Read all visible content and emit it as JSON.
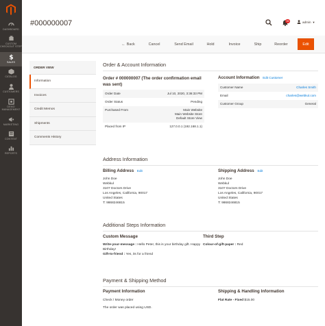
{
  "nav": {
    "items": [
      {
        "label": "Dashboard",
        "icon": "dashboard-icon"
      },
      {
        "label": "Custom Checkout Step",
        "icon": "checkout-step-icon"
      },
      {
        "label": "Sales",
        "icon": "dollar-icon"
      },
      {
        "label": "Catalog",
        "icon": "catalog-icon"
      },
      {
        "label": "Customers",
        "icon": "customers-icon"
      },
      {
        "label": "Demo Management",
        "icon": "demo-management-icon"
      },
      {
        "label": "Marketing",
        "icon": "marketing-icon"
      },
      {
        "label": "Content",
        "icon": "content-icon"
      },
      {
        "label": "Reports",
        "icon": "reports-icon"
      }
    ],
    "accent": "#eb5202"
  },
  "header": {
    "title": "#000000007",
    "notification_count": "39",
    "user": "admin"
  },
  "actions": {
    "back": "Back",
    "cancel": "Cancel",
    "send_email": "Send Email",
    "hold": "Hold",
    "invoice": "Invoice",
    "ship": "Ship",
    "reorder": "Reorder",
    "edit": "Edit"
  },
  "tabs": {
    "title": "Order View",
    "items": [
      "Information",
      "Invoices",
      "Credit Memos",
      "Shipments",
      "Comments History"
    ]
  },
  "order_account": {
    "section_title": "Order & Account Information",
    "order_heading": "Order # 000000007 (The order confirmation email was sent)",
    "rows": [
      {
        "label": "Order Date",
        "value": "Jul 10, 2020, 3:36:33 PM"
      },
      {
        "label": "Order Status",
        "value": "Pending"
      },
      {
        "label": "Purchased From",
        "value_lines": [
          "Main Website",
          "Main Website Store",
          "Default Store View"
        ]
      },
      {
        "label": "Placed from IP",
        "value": "127.0.0.1 (192.168.1.1)"
      }
    ],
    "account_heading": "Account Information",
    "account_edit": "Edit Customer",
    "account_rows": [
      {
        "label": "Customer Name",
        "value": "Charles Smith"
      },
      {
        "label": "Email",
        "value": "charles@webkul.com"
      },
      {
        "label": "Customer Group",
        "value": "General"
      }
    ]
  },
  "address": {
    "section_title": "Address Information",
    "billing_heading": "Billing Address",
    "shipping_heading": "Shipping Address",
    "edit": "Edit",
    "billing_lines": [
      "John Doe",
      "Webkul",
      "3107 Doctors Drive",
      "Los Angeles, California, 90017",
      "United States",
      "T: 9868246815"
    ],
    "shipping_lines": [
      "John Doe",
      "Webkul",
      "3107 Doctors Drive",
      "Los Angeles, California, 90017",
      "United States",
      "T: 9868246815"
    ]
  },
  "steps": {
    "section_title": "Additional Steps Information",
    "custom_heading": "Custom Message",
    "write_label": "Write-your-message :",
    "write_value": "Hello Peter, this is your birthday gift. Happy Birthday!",
    "gift_label": "Gift-to-friend :",
    "gift_value": "Yes, its for a friend",
    "third_heading": "Third Step",
    "colour_label": "Colour-of-gift-paper :",
    "colour_value": "Red"
  },
  "payment": {
    "section_title": "Payment & Shipping Method",
    "payment_heading": "Payment Information",
    "method": "Check / Money order",
    "currency_note": "The order was placed using USD.",
    "shipping_heading": "Shipping & Handling Information",
    "rate_label": "Flat Rate - Fixed",
    "rate_value": "$15.00"
  }
}
